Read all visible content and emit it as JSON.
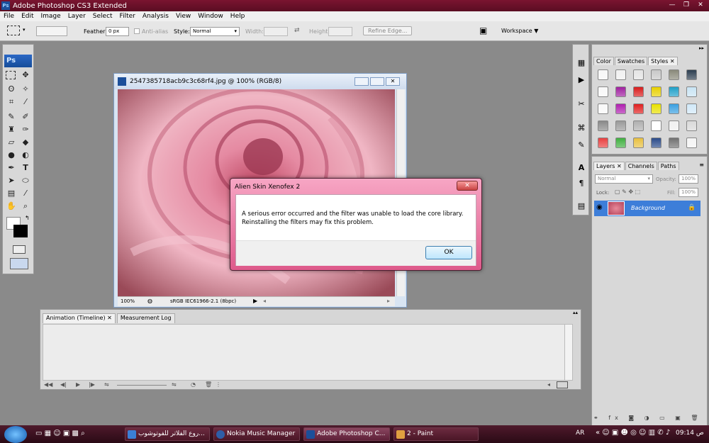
{
  "window": {
    "title": "Adobe Photoshop CS3 Extended",
    "app_icon": "Ps"
  },
  "menu": [
    "File",
    "Edit",
    "Image",
    "Layer",
    "Select",
    "Filter",
    "Analysis",
    "View",
    "Window",
    "Help"
  ],
  "options": {
    "feather_label": "Feather:",
    "feather_value": "0 px",
    "antialias_label": "Anti-alias",
    "style_label": "Style:",
    "style_value": "Normal",
    "width_label": "Width:",
    "height_label": "Height:",
    "refine_edge": "Refine Edge...",
    "workspace": "Workspace"
  },
  "tools": {
    "logo": "Ps"
  },
  "document": {
    "title": "2547385718acb9c3c68rf4.jpg @ 100% (RGB/8)",
    "zoom": "100%",
    "profile": "sRGB IEC61966-2.1 (8bpc)"
  },
  "dialog": {
    "title": "Alien Skin Xenofex 2",
    "close": "✕",
    "line1": "A serious error occurred and the filter was unable to load the core library.",
    "line2": "Reinstalling the filters may fix this problem.",
    "ok": "OK"
  },
  "animation": {
    "tabs": [
      "Animation (Timeline)",
      "Measurement Log"
    ]
  },
  "styles_panel": {
    "tabs": [
      "Color",
      "Swatches",
      "Styles"
    ]
  },
  "layers_panel": {
    "tabs": [
      "Layers",
      "Channels",
      "Paths"
    ],
    "blend": "Normal",
    "opacity_label": "Opacity:",
    "opacity_value": "100%",
    "lock_label": "Lock:",
    "fill_label": "Fill:",
    "fill_value": "100%",
    "layer_name": "Background"
  },
  "taskbar": {
    "items": [
      "روع الفلاتر للفوتوشوب...",
      "Nokia Music Manager",
      "Adobe Photoshop C...",
      "2 - Paint"
    ],
    "lang": "AR",
    "time": "09:14 ص"
  },
  "colors": {
    "accent": "#7a1430",
    "layer_selected": "#3d7ed9"
  }
}
